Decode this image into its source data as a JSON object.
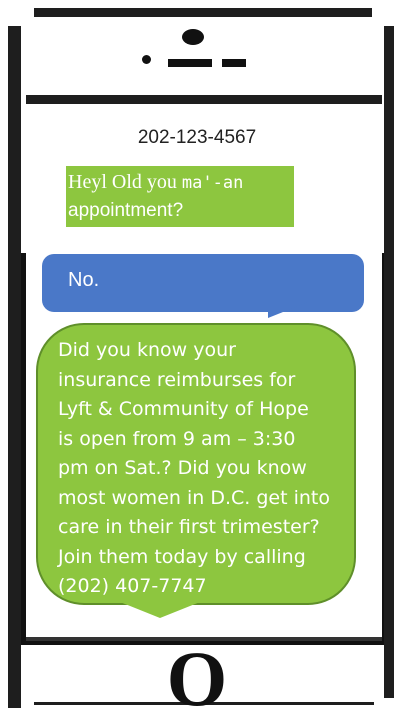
{
  "contact": {
    "phone_number": "202-123-4567"
  },
  "messages": [
    {
      "direction": "incoming",
      "parts": [
        "Heyl",
        " Old",
        " you ",
        "ma'-an",
        "appointment?"
      ]
    },
    {
      "direction": "outgoing",
      "text": "No."
    },
    {
      "direction": "incoming",
      "text": "Did you know your\ninsurance reimburses for\nLyft & Community of Hope\nis open from 9 am – 3:30\npm on Sat.? Did you know\nmost women in D.C. get into\ncare in their first trimester?\nJoin them today by calling\n(202) 407-7747"
    }
  ],
  "device": {
    "home_button_glyph": "O"
  },
  "colors": {
    "green_bubble": "#8dc63f",
    "blue_bubble": "#4a78c8",
    "frame": "#1e1e1e"
  }
}
